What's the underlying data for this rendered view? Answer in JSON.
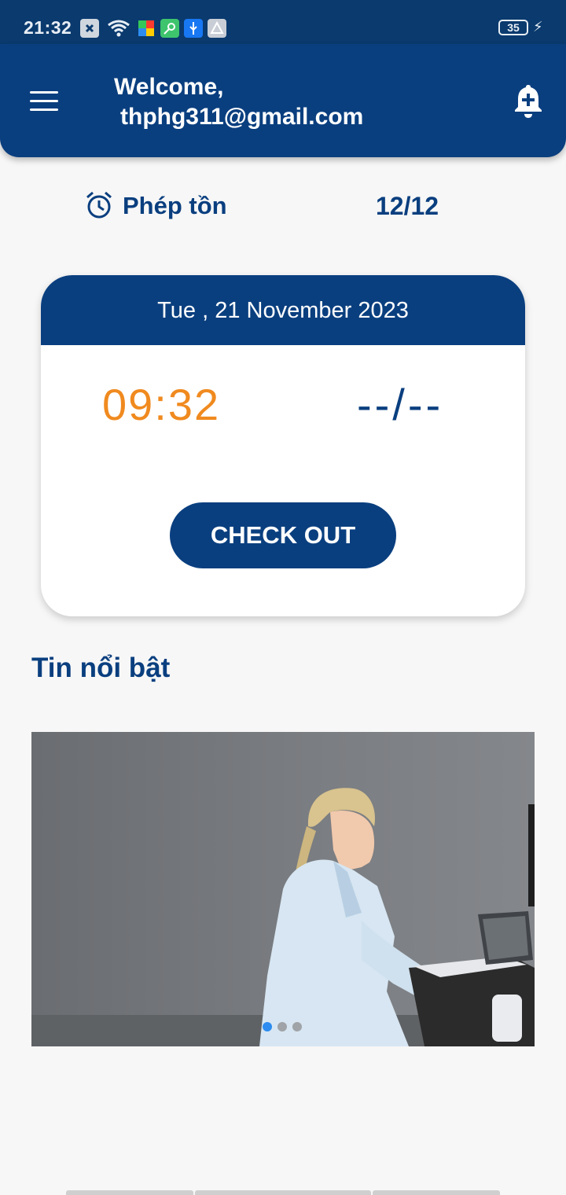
{
  "status_bar": {
    "time": "21:32",
    "icons": [
      "notification-x-icon",
      "wifi-icon",
      "puzzle-icon",
      "key-icon",
      "usb-icon",
      "triangle-icon"
    ],
    "battery_level": "35",
    "charging": true
  },
  "header": {
    "welcome_label": "Welcome,",
    "email": "thphg311@gmail.com",
    "background_color": "#0a3f7f"
  },
  "leave": {
    "label": "Phép tồn",
    "value": "12/12"
  },
  "attendance_card": {
    "date": "Tue , 21 November 2023",
    "check_in_time": "09:32",
    "check_out_time": "--/--",
    "button_label": "CHECK OUT",
    "accent_color": "#f08a1f"
  },
  "news": {
    "title": "Tin nổi bật",
    "slides": 3,
    "active_slide": 0,
    "image_description": "doctor-ultrasound-photo"
  }
}
